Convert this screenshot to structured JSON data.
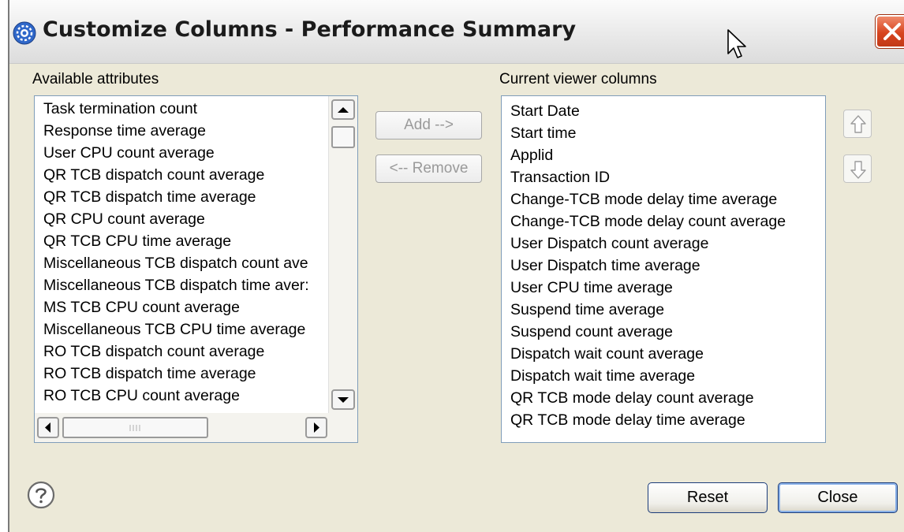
{
  "window": {
    "title": "Customize Columns - Performance Summary",
    "icons": {
      "app": "gear-badge-icon",
      "close": "close-icon",
      "cursor": "mouse-pointer-icon"
    }
  },
  "available": {
    "label": "Available attributes",
    "items": [
      "Task termination count",
      "Response time average",
      "User CPU count average",
      "QR TCB dispatch count average",
      "QR TCB dispatch time average",
      "QR CPU count average",
      "QR TCB CPU time average",
      "Miscellaneous TCB dispatch count ave",
      "Miscellaneous TCB dispatch time aver:",
      "MS TCB CPU count average",
      "Miscellaneous TCB CPU time average",
      "RO TCB dispatch count average",
      "RO TCB dispatch time average",
      "RO TCB CPU count average"
    ]
  },
  "actions": {
    "add_label": "Add -->",
    "remove_label": "<-- Remove"
  },
  "current": {
    "label": "Current viewer columns",
    "items": [
      "Start Date",
      "Start time",
      "Applid",
      "Transaction ID",
      "Change-TCB mode delay time average",
      "Change-TCB mode delay count average",
      "User Dispatch count average",
      "User Dispatch time average",
      "User CPU time average",
      "Suspend time average",
      "Suspend count average",
      "Dispatch wait count average",
      "Dispatch wait time average",
      "QR TCB mode delay count average",
      "QR TCB mode delay time average"
    ]
  },
  "footer": {
    "reset_label": "Reset",
    "close_label": "Close",
    "help_icon": "help-icon"
  },
  "colors": {
    "list_border": "#7f9db9",
    "dialog_bg": "#ece9d8",
    "close_red": "#d7441f"
  }
}
